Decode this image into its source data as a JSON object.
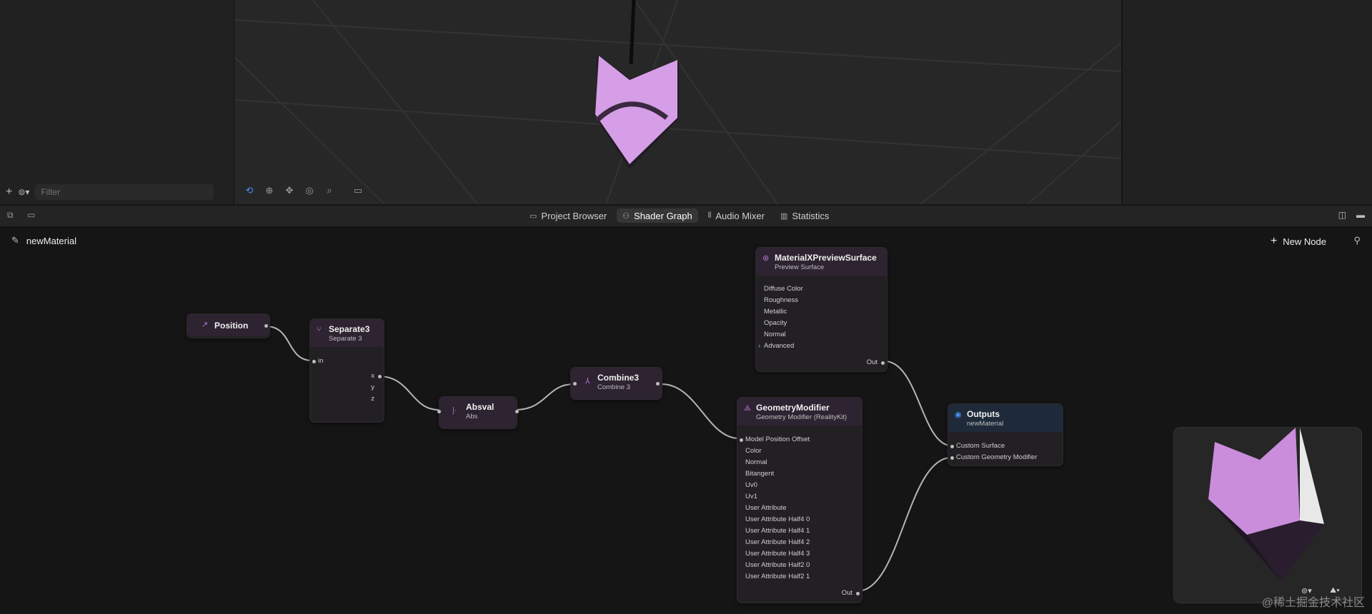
{
  "filter": {
    "placeholder": "Filter"
  },
  "tabs": [
    {
      "label": "Project Browser",
      "icon": "folder-icon"
    },
    {
      "label": "Shader Graph",
      "icon": "nodes-icon"
    },
    {
      "label": "Audio Mixer",
      "icon": "mixer-icon"
    },
    {
      "label": "Statistics",
      "icon": "chart-icon"
    }
  ],
  "graph": {
    "material_name": "newMaterial",
    "new_node_label": "New Node"
  },
  "nodes": {
    "position": {
      "title": "Position"
    },
    "separate3": {
      "title": "Separate3",
      "subtitle": "Separate 3",
      "in": "in",
      "outs": [
        "x",
        "y",
        "z"
      ]
    },
    "absval": {
      "title": "Absval",
      "subtitle": "Abs"
    },
    "combine3": {
      "title": "Combine3",
      "subtitle": "Combine 3"
    },
    "preview": {
      "title": "MaterialXPreviewSurface",
      "subtitle": "Preview Surface",
      "inputs": [
        "Diffuse Color",
        "Roughness",
        "Metallic",
        "Opacity",
        "Normal",
        "Advanced"
      ],
      "out": "Out"
    },
    "geometry": {
      "title": "GeometryModifier",
      "subtitle": "Geometry Modifier (RealityKit)",
      "inputs": [
        "Model Position Offset",
        "Color",
        "Normal",
        "Bitangent",
        "Uv0",
        "Uv1",
        "User Attribute",
        "User Attribute Half4 0",
        "User Attribute Half4 1",
        "User Attribute Half4 2",
        "User Attribute Half4 3",
        "User Attribute Half2 0",
        "User Attribute Half2 1"
      ],
      "out": "Out"
    },
    "outputs": {
      "title": "Outputs",
      "subtitle": "newMaterial",
      "inputs": [
        "Custom Surface",
        "Custom Geometry Modifier"
      ]
    }
  },
  "watermark": "@稀土掘金技术社区",
  "colors": {
    "accent_purple": "#b572d9",
    "model_pink": "#d59ee6",
    "canvas": "#151515"
  }
}
